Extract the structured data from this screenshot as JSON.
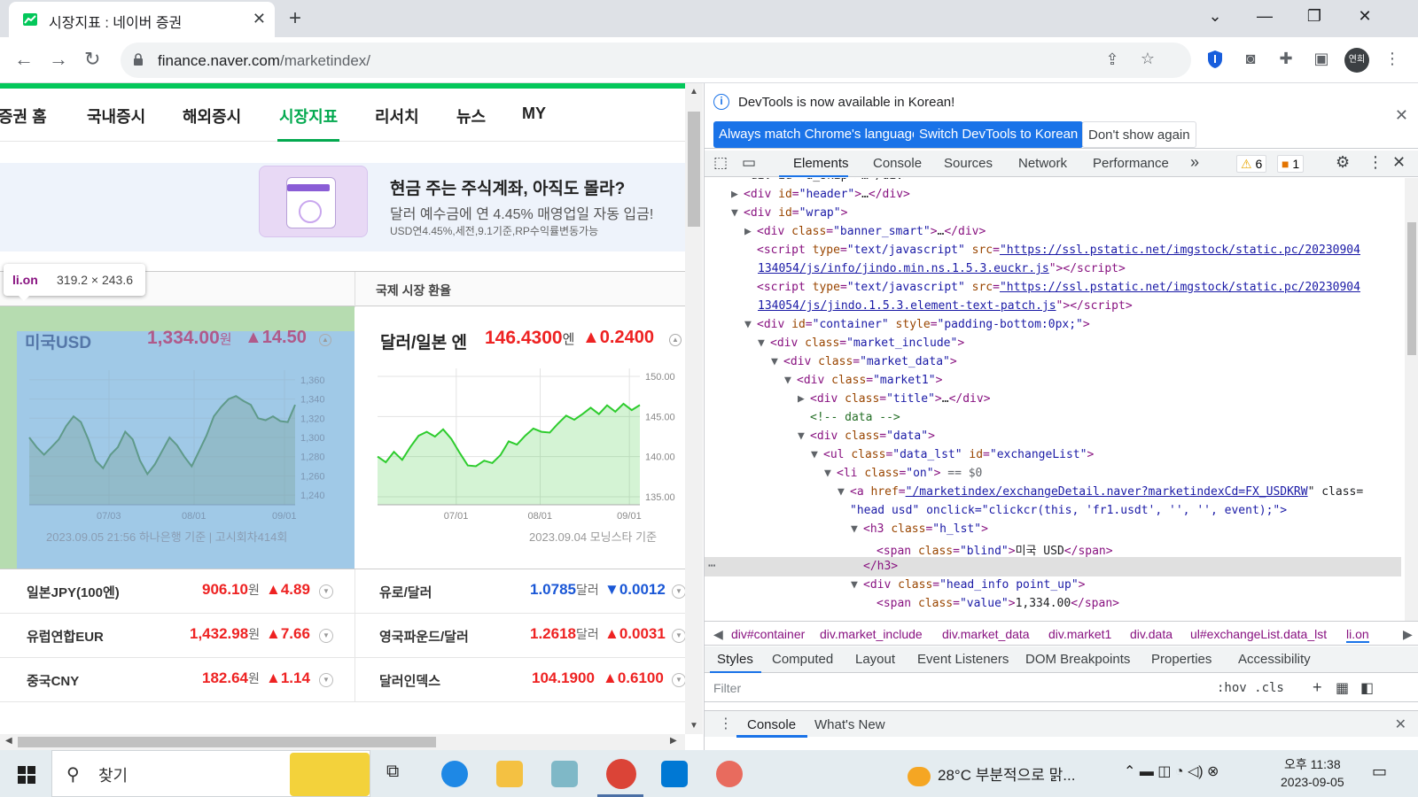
{
  "browser": {
    "tab_title": "시장지표 : 네이버 증권",
    "tab_close": "✕",
    "new_tab": "+",
    "url_host": "finance.naver.com",
    "url_path": "/marketindex/",
    "profile": "연희",
    "win_controls": [
      "⌄",
      "—",
      "❐",
      "✕"
    ]
  },
  "nav": {
    "items": [
      "증권 홈",
      "국내증시",
      "해외증시",
      "시장지표",
      "리서치",
      "뉴스",
      "MY"
    ],
    "active": "시장지표"
  },
  "banner": {
    "headline": "현금 주는 주식계좌, 아직도 몰라?",
    "subline": "달러 예수금에 연 4.45% 매영업일 자동 입금!",
    "note": "USD연4.45%,세전,9.1기준,RP수익률변동가능"
  },
  "market": {
    "right_header": "국제 시장 환율",
    "tooltip": {
      "name": "li.on",
      "dims": "319.2 × 243.6"
    },
    "left_card": {
      "name": "미국USD",
      "value": "1,334.00",
      "unit": "원",
      "change": "▲14.50",
      "y_ticks": [
        "1,360",
        "1,340",
        "1,320",
        "1,300",
        "1,280",
        "1,260",
        "1,240"
      ],
      "x_ticks": [
        "07/03",
        "08/01",
        "09/01"
      ],
      "source": "2023.09.05 21:56 하나은행 기준 | 고시회차414회"
    },
    "right_card": {
      "name": "달러/일본 엔",
      "value": "146.4300",
      "unit": "엔",
      "change": "▲0.2400",
      "y_ticks": [
        "150.00",
        "145.00",
        "140.00",
        "135.00"
      ],
      "x_ticks": [
        "07/01",
        "08/01",
        "09/01"
      ],
      "source": "2023.09.04 모닝스타 기준"
    },
    "rows": [
      {
        "l_name": "일본JPY(100엔)",
        "l_val": "906.10",
        "l_unit": "원",
        "l_chg": "▲4.89",
        "r_name": "유로/달러",
        "r_val": "1.0785",
        "r_unit": "달러",
        "r_chg": "▼0.0012"
      },
      {
        "l_name": "유럽연합EUR",
        "l_val": "1,432.98",
        "l_unit": "원",
        "l_chg": "▲7.66",
        "r_name": "영국파운드/달러",
        "r_val": "1.2618",
        "r_unit": "달러",
        "r_chg": "▲0.0031"
      },
      {
        "l_name": "중국CNY",
        "l_val": "182.64",
        "l_unit": "원",
        "l_chg": "▲1.14",
        "r_name": "달러인덱스",
        "r_val": "104.1900",
        "r_unit": "",
        "r_chg": "▲0.6100"
      }
    ]
  },
  "chart_data": [
    {
      "type": "area",
      "title": "미국USD",
      "x": [
        "07/03",
        "08/01",
        "09/01"
      ],
      "ylim": [
        1230,
        1370
      ],
      "values": [
        1300,
        1290,
        1282,
        1290,
        1298,
        1312,
        1322,
        1316,
        1298,
        1276,
        1268,
        1282,
        1290,
        1306,
        1298,
        1276,
        1262,
        1272,
        1286,
        1300,
        1292,
        1280,
        1270,
        1286,
        1302,
        1322,
        1332,
        1340,
        1343,
        1338,
        1334,
        1320,
        1318,
        1322,
        1317,
        1316,
        1334
      ]
    },
    {
      "type": "area",
      "title": "달러/일본 엔",
      "x": [
        "07/01",
        "08/01",
        "09/01"
      ],
      "ylim": [
        134,
        151
      ],
      "values": [
        140.0,
        139.3,
        140.6,
        139.6,
        141.2,
        142.6,
        143.1,
        142.5,
        143.4,
        142.2,
        140.5,
        138.9,
        138.8,
        139.5,
        139.2,
        140.2,
        141.9,
        141.5,
        142.6,
        143.5,
        143.1,
        143.0,
        144.1,
        145.1,
        144.6,
        145.3,
        146.1,
        145.3,
        146.4,
        145.6,
        146.6,
        145.8,
        146.43
      ]
    }
  ],
  "devtools": {
    "info": "DevTools is now available in Korean!",
    "btn_match": "Always match Chrome's language",
    "btn_switch": "Switch DevTools to Korean",
    "btn_dismiss": "Don't show again",
    "tabs": [
      "Elements",
      "Console",
      "Sources",
      "Network",
      "Performance"
    ],
    "more": "»",
    "warn_count": "6",
    "err_count": "1",
    "dom": [
      {
        "indent": 0,
        "tri": "",
        "html": "<span class='tx'>&lt;div id=\"a_skip\"&gt;…&lt;/div&gt;</span>"
      },
      {
        "indent": 0,
        "tri": "▶",
        "tag": "div",
        "attrs": [
          [
            "id",
            "header"
          ]
        ],
        "collapsed": true
      },
      {
        "indent": 0,
        "tri": "▼",
        "tag": "div",
        "attrs": [
          [
            "id",
            "wrap"
          ]
        ]
      },
      {
        "indent": 1,
        "tri": "▶",
        "tag": "div",
        "attrs": [
          [
            "class",
            "banner_smart"
          ]
        ],
        "collapsed": true
      },
      {
        "indent": 1,
        "tri": "",
        "tag": "script",
        "attrs": [
          [
            "type",
            "text/javascript"
          ],
          [
            "src",
            "https://ssl.pstatic.net/imgstock/static.pc/20230904"
          ]
        ],
        "link": true,
        "close": false
      },
      {
        "indent": 1,
        "tri": "",
        "cont": "134054/js/info/jindo.min.ns.1.5.3.euckr.js",
        "after": "\"&gt;&lt;/script&gt;"
      },
      {
        "indent": 1,
        "tri": "",
        "tag": "script",
        "attrs": [
          [
            "type",
            "text/javascript"
          ],
          [
            "src",
            "https://ssl.pstatic.net/imgstock/static.pc/20230904"
          ]
        ],
        "link": true,
        "close": false
      },
      {
        "indent": 1,
        "tri": "",
        "cont": "134054/js/jindo.1.5.3.element-text-patch.js",
        "after": "\"&gt;&lt;/script&gt;"
      },
      {
        "indent": 1,
        "tri": "▼",
        "tag": "div",
        "attrs": [
          [
            "id",
            "container"
          ],
          [
            "style",
            "padding-bottom:0px;"
          ]
        ]
      },
      {
        "indent": 2,
        "tri": "▼",
        "tag": "div",
        "attrs": [
          [
            "class",
            "market_include"
          ]
        ]
      },
      {
        "indent": 3,
        "tri": "▼",
        "tag": "div",
        "attrs": [
          [
            "class",
            "market_data"
          ]
        ]
      },
      {
        "indent": 4,
        "tri": "▼",
        "tag": "div",
        "attrs": [
          [
            "class",
            "market1"
          ]
        ]
      },
      {
        "indent": 5,
        "tri": "▶",
        "tag": "div",
        "attrs": [
          [
            "class",
            "title"
          ]
        ],
        "collapsed": true
      },
      {
        "indent": 5,
        "tri": "",
        "comment": "&lt;!-- data --&gt;"
      },
      {
        "indent": 5,
        "tri": "▼",
        "tag": "div",
        "attrs": [
          [
            "class",
            "data"
          ]
        ]
      },
      {
        "indent": 6,
        "tri": "▼",
        "tag": "ul",
        "attrs": [
          [
            "class",
            "data_lst"
          ],
          [
            "id",
            "exchangeList"
          ]
        ]
      },
      {
        "indent": 7,
        "tri": "▼",
        "tag": "li",
        "attrs": [
          [
            "class",
            "on"
          ]
        ],
        "sel": " == $0"
      },
      {
        "indent": 8,
        "tri": "▼",
        "tag": "a",
        "attrs": [
          [
            "href",
            "/marketindex/exchangeDetail.naver?marketindexCd=FX_USDKRW"
          ]
        ],
        "link": true,
        "close": false,
        "tail": " class="
      },
      {
        "indent": 8,
        "tri": "",
        "cont2": "\"head usd\" onclick=\"clickcr(this, 'fr1.usdt', '', '', event);\"&gt;"
      },
      {
        "indent": 9,
        "tri": "▼",
        "tag": "h3",
        "attrs": [
          [
            "class",
            "h_lst"
          ]
        ]
      },
      {
        "indent": 10,
        "tri": "",
        "span": [
          "blind",
          "미국 USD"
        ]
      },
      {
        "indent": 9,
        "tri": "",
        "closetag": "h3"
      },
      {
        "indent": 9,
        "tri": "▼",
        "tag": "div",
        "attrs": [
          [
            "class",
            "head_info point_up"
          ]
        ]
      },
      {
        "indent": 10,
        "tri": "",
        "span": [
          "value",
          "1,334.00"
        ]
      }
    ],
    "crumbs": [
      "div#container",
      "div.market_include",
      "div.market_data",
      "div.market1",
      "div.data",
      "ul#exchangeList.data_lst",
      "li.on"
    ],
    "style_tabs": [
      "Styles",
      "Computed",
      "Layout",
      "Event Listeners",
      "DOM Breakpoints",
      "Properties",
      "Accessibility"
    ],
    "filter_placeholder": "Filter",
    "filter_tools": ":hov  .cls",
    "drawer_tabs": [
      "Console",
      "What's New"
    ]
  },
  "taskbar": {
    "search_placeholder": "찾기",
    "weather": "28°C  부분적으로 맑...",
    "time": "오후 11:38",
    "date": "2023-09-05"
  }
}
